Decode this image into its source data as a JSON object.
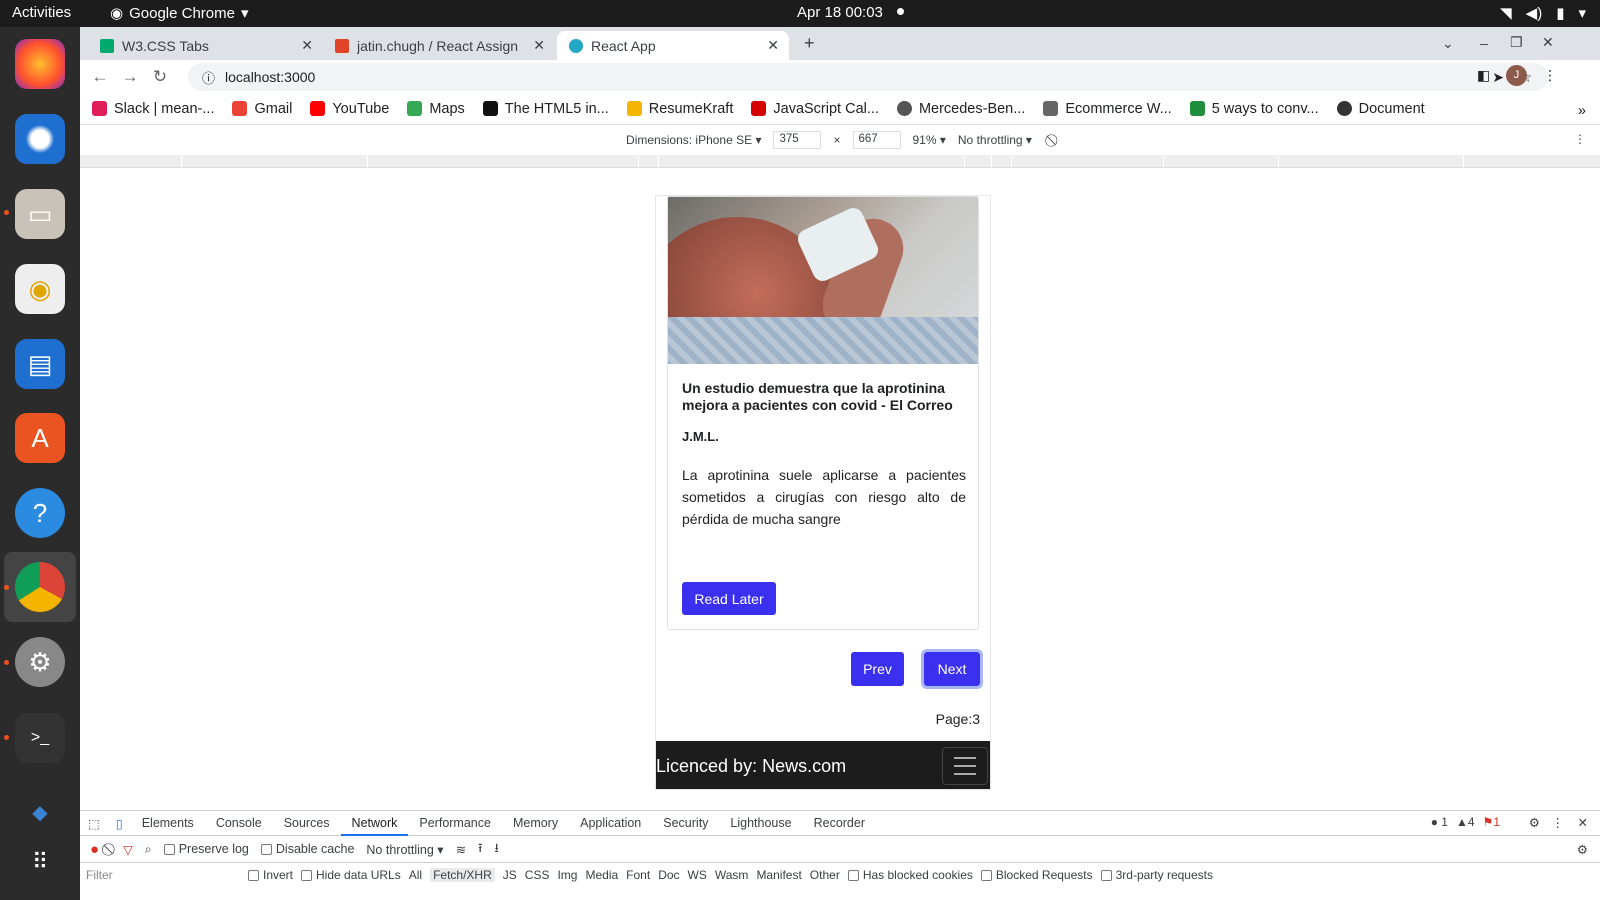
{
  "system": {
    "activities": "Activities",
    "app_name": "Google Chrome",
    "datetime": "Apr 18  00:03"
  },
  "tabs": [
    {
      "title": "W3.CSS Tabs",
      "color": "#04aa6d"
    },
    {
      "title": "jatin.chugh / React Assign",
      "color": "#e24329"
    },
    {
      "title": "React App",
      "color": "#22a7c4"
    }
  ],
  "address": {
    "url": "localhost:3000"
  },
  "profile_initial": "J",
  "bookmarks": [
    {
      "label": "Slack | mean-...",
      "color": "#e01e5a"
    },
    {
      "label": "Gmail",
      "color": "#ea4335"
    },
    {
      "label": "YouTube",
      "color": "#ff0000"
    },
    {
      "label": "Maps",
      "color": "#34a853"
    },
    {
      "label": "The HTML5 in...",
      "color": "#111111"
    },
    {
      "label": "ResumeKraft",
      "color": "#f4b400"
    },
    {
      "label": "JavaScript Cal...",
      "color": "#d50000"
    },
    {
      "label": "Mercedes-Ben...",
      "color": "#555555"
    },
    {
      "label": "Ecommerce W...",
      "color": "#666666"
    },
    {
      "label": "5 ways to conv...",
      "color": "#1e8e3e"
    },
    {
      "label": "Document",
      "color": "#333333"
    }
  ],
  "device": {
    "dimensions": "Dimensions: iPhone SE",
    "width": "375",
    "times": "×",
    "height": "667",
    "zoom": "91%",
    "throttling": "No throttling"
  },
  "article": {
    "title": "Un estudio demuestra que la aprotinina mejora a pacientes con covid - El Correo",
    "author": "J.M.L.",
    "description": "La aprotinina suele aplicarse a pacientes sometidos a cirugías con riesgo alto de pérdida de mucha sangre",
    "read_later": "Read Later"
  },
  "pagination": {
    "prev": "Prev",
    "next": "Next",
    "page": "Page:3"
  },
  "footer": {
    "text": "Licenced by: News.com"
  },
  "devtools": {
    "tabs": [
      "Elements",
      "Console",
      "Sources",
      "Network",
      "Performance",
      "Memory",
      "Application",
      "Security",
      "Lighthouse",
      "Recorder"
    ],
    "active_tab": "Network",
    "counts": {
      "errors": "1",
      "warnings": "4",
      "issues": "1"
    },
    "preserve_log": "Preserve log",
    "disable_cache": "Disable cache",
    "throttling": "No throttling",
    "filter_placeholder": "Filter",
    "invert": "Invert",
    "hide_data_urls": "Hide data URLs",
    "types": [
      "All",
      "Fetch/XHR",
      "JS",
      "CSS",
      "Img",
      "Media",
      "Font",
      "Doc",
      "WS",
      "Wasm",
      "Manifest",
      "Other"
    ],
    "has_blocked_cookies": "Has blocked cookies",
    "blocked_requests": "Blocked Requests",
    "third_party": "3rd-party requests"
  }
}
